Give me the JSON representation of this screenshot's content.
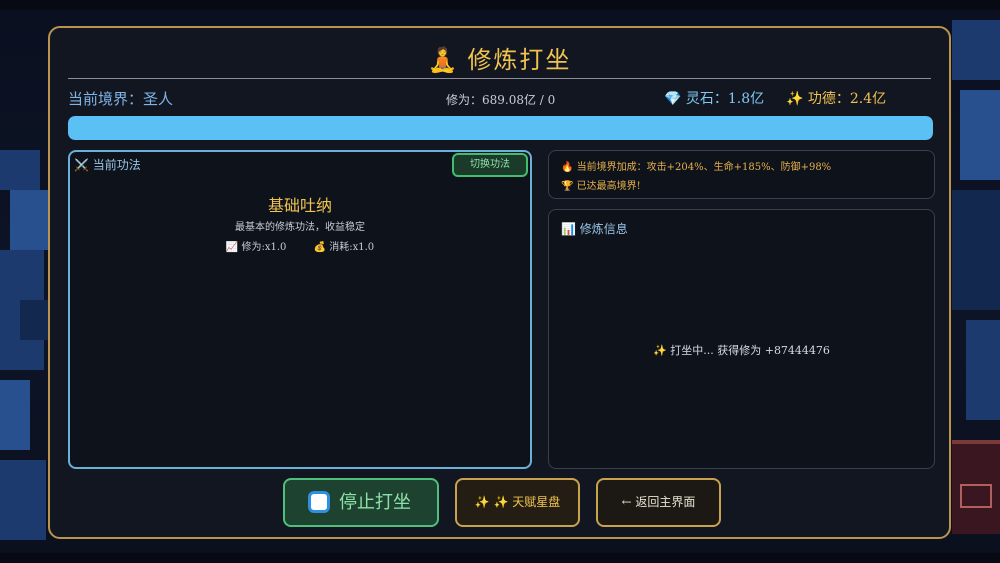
{
  "title": {
    "icon": "meditation-icon",
    "icon_glyph": "🧘",
    "text": "修炼打坐"
  },
  "stats": {
    "realm": "当前境界：圣人",
    "cultivation": "修为：689.08亿 / 0",
    "stones": "灵石：1.8亿",
    "stones_icon": "💎",
    "merit": "功德：2.4亿",
    "merit_icon": "✨"
  },
  "progress": {
    "fraction": 1.0,
    "color": "#5bc0f3"
  },
  "technique": {
    "header": "当前功法",
    "header_icon": "⚔️",
    "switch_label": "切换功法",
    "name": "基础吐纳",
    "description": "最基本的修炼功法，收益稳定",
    "mod_cult_icon": "📈",
    "mod_cult": "修为:x1.0",
    "mod_cost_icon": "💰",
    "mod_cost": "消耗:x1.0"
  },
  "bonus": {
    "line1_icon": "🔥",
    "line1": "当前境界加成：攻击+204%、生命+185%、防御+98%",
    "line2_icon": "🏆",
    "line2": "已达最高境界!"
  },
  "info": {
    "header_icon": "📊",
    "header": "修炼信息",
    "message": "✨ 打坐中... 获得修为 +87444476"
  },
  "buttons": {
    "stop": "停止打坐",
    "talent": "✨ ✨ 天赋星盘",
    "back": "← 返回主界面"
  },
  "colors": {
    "gold": "#f0c350",
    "accent_blue": "#6ab0d8",
    "green": "#4fc07c",
    "border_gold": "#b8944e"
  }
}
